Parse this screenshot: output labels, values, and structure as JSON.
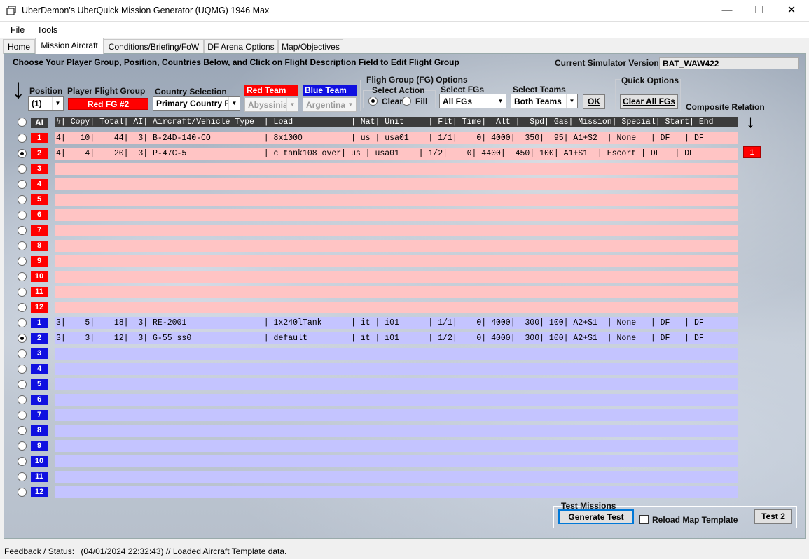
{
  "window": {
    "title": "UberDemon's UberQuick Mission Generator (UQMG) 1946 Max",
    "minimize": "—",
    "maximize": "☐",
    "close": "✕"
  },
  "menu": {
    "file": "File",
    "tools": "Tools"
  },
  "tabs": [
    "Home",
    "Mission Aircraft",
    "Conditions/Briefing/FoW",
    "DF Arena Options",
    "Map/Objectives"
  ],
  "instructions": "Choose Your Player Group, Position, Countries Below, and Click on Flight Description Field to Edit Flight Group",
  "sim_version": {
    "label": "Current Simulator Version:",
    "value": "BAT_WAW422"
  },
  "position": {
    "label": "Position",
    "value": "(1)"
  },
  "player_fg": {
    "label": "Player Flight Group",
    "value": "Red FG #2"
  },
  "country": {
    "label": "Country Selection",
    "value": "Primary Country F"
  },
  "red_team": {
    "label": "Red Team",
    "value": "Abyssinia",
    "color": "#ff0000"
  },
  "blue_team": {
    "label": "Blue Team",
    "value": "Argentina",
    "color": "#1010e0"
  },
  "fg_options": {
    "title": "Fligh Group (FG) Options",
    "select_action": "Select Action",
    "clear": "Clear",
    "fill": "Fill",
    "select_fgs": "Select FGs",
    "fgs_value": "All FGs",
    "select_teams": "Select Teams",
    "teams_value": "Both Teams",
    "ok": "OK"
  },
  "quick_options": {
    "title": "Quick Options",
    "clear_all": "Clear All FGs"
  },
  "composite": {
    "label": "Composite Relation",
    "badge": "1"
  },
  "ai_label": "AI",
  "table_header": "#| Copy| Total| AI| Aircraft/Vehicle Type  | Load            | Nat| Unit     | Flt| Time|  Alt |  Spd| Gas| Mission| Special| Start| End",
  "red_rows": [
    {
      "n": "1",
      "text": "4|   10|    44|  3| B-24D-140-CO           | 8x1000          | us | usa01    | 1/1|    0| 4000|  350|  95| A1+S2  | None   | DF   | DF"
    },
    {
      "n": "2",
      "text": "4|    4|    20|  3| P-47C-5                | c tank108 over| us | usa01    | 1/2|    0| 4400|  450| 100| A1+S1  | Escort | DF   | DF"
    },
    {
      "n": "3",
      "text": ""
    },
    {
      "n": "4",
      "text": ""
    },
    {
      "n": "5",
      "text": ""
    },
    {
      "n": "6",
      "text": ""
    },
    {
      "n": "7",
      "text": ""
    },
    {
      "n": "8",
      "text": ""
    },
    {
      "n": "9",
      "text": ""
    },
    {
      "n": "10",
      "text": ""
    },
    {
      "n": "11",
      "text": ""
    },
    {
      "n": "12",
      "text": ""
    }
  ],
  "blue_rows": [
    {
      "n": "1",
      "text": "3|    5|    18|  3| RE-2001                | 1x240lTank      | it | i01      | 1/1|    0| 4000|  300| 100| A2+S1  | None   | DF   | DF"
    },
    {
      "n": "2",
      "text": "3|    3|    12|  3| G-55 ss0               | default         | it | i01      | 1/2|    0| 4000|  300| 100| A2+S1  | None   | DF   | DF"
    },
    {
      "n": "3",
      "text": ""
    },
    {
      "n": "4",
      "text": ""
    },
    {
      "n": "5",
      "text": ""
    },
    {
      "n": "6",
      "text": ""
    },
    {
      "n": "7",
      "text": ""
    },
    {
      "n": "8",
      "text": ""
    },
    {
      "n": "9",
      "text": ""
    },
    {
      "n": "10",
      "text": ""
    },
    {
      "n": "11",
      "text": ""
    },
    {
      "n": "12",
      "text": ""
    }
  ],
  "test_missions": {
    "title": "Test Missions",
    "generate": "Generate Test",
    "reload": "Reload Map Template",
    "test2": "Test 2"
  },
  "status": {
    "label": "Feedback / Status:",
    "text": "(04/01/2024 22:32:43) // Loaded Aircraft Template data."
  }
}
